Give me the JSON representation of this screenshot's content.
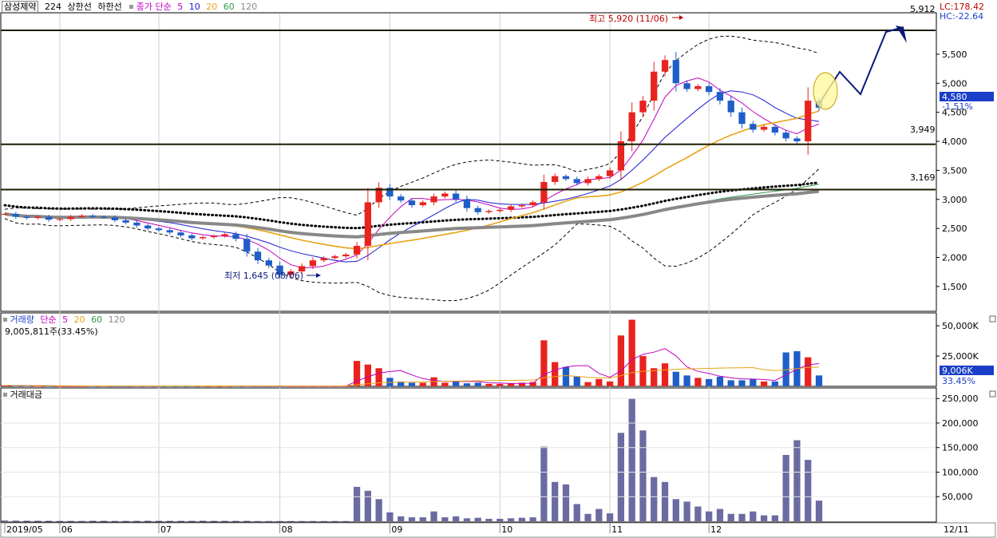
{
  "header": {
    "stock_name": "삼성제약",
    "code": "224",
    "upper_limit": "상한선",
    "lower_limit": "하한선",
    "price_ma_title": "종가 단순",
    "ma_periods": [
      "5",
      "10",
      "20",
      "60",
      "120"
    ],
    "lc_label": "LC:178.42",
    "hc_label": "HC:-22.64"
  },
  "volume_header": {
    "title": "거래량",
    "ma_title": "단순",
    "ma_periods": [
      "5",
      "20",
      "60",
      "120"
    ],
    "value_text": "9,005,811주(33.45%)"
  },
  "amount_header": {
    "title": "거래대금"
  },
  "annotations": {
    "high_label": "최고 5,920 (11/06)",
    "low_label": "최저 1,645 (08/06)",
    "level_top": "5,912",
    "level_mid": "3,949",
    "level_low": "3,169"
  },
  "current": {
    "price": "4,580",
    "change": "-1.51%",
    "volume": "9,006K",
    "volume_pct": "33.45%"
  },
  "x_axis": {
    "labels": [
      "2019/05",
      "06",
      "07",
      "08",
      "09",
      "10",
      "11",
      "12"
    ],
    "right_label": "12/11"
  },
  "colors": {
    "up": "#e8231f",
    "down": "#1f5ec8",
    "ma5": "#c000c0",
    "ma10": "#1b1bd0",
    "ma20": "#e8a317",
    "ma60": "#2e9a4a",
    "ma120": "#888888",
    "level_line": "#1c1c00"
  },
  "chart_data": [
    {
      "type": "candlestick",
      "title": "삼성제약",
      "price_axis_ticks": [
        1500,
        2000,
        2500,
        3000,
        3500,
        4000,
        4500,
        5000,
        5500
      ],
      "ylim": [
        1100,
        6200
      ],
      "horizontal_levels": [
        5912,
        3949,
        3169
      ],
      "series": [
        {
          "name": "종가",
          "values": [
            2750,
            2700,
            2680,
            2700,
            2650,
            2660,
            2700,
            2720,
            2700,
            2690,
            2640,
            2600,
            2550,
            2500,
            2470,
            2430,
            2380,
            2330,
            2350,
            2370,
            2400,
            2320,
            2100,
            1950,
            1860,
            1700,
            1760,
            1850,
            1950,
            1990,
            2020,
            2050,
            2200,
            2950,
            3200,
            3050,
            2980,
            2900,
            2950,
            3050,
            3100,
            3000,
            2850,
            2780,
            2800,
            2820,
            2880,
            2900,
            2950,
            3300,
            3400,
            3350,
            3280,
            3350,
            3400,
            3500,
            4000,
            4500,
            4700,
            5200,
            5400,
            5000,
            4900,
            4950,
            4850,
            4700,
            4500,
            4300,
            4200,
            4250,
            4150,
            4050,
            4000,
            4700,
            4580
          ]
        }
      ]
    },
    {
      "type": "bar",
      "title": "거래량",
      "yticks": [
        25000,
        50000
      ],
      "unit": "K",
      "values": [
        700,
        500,
        400,
        300,
        300,
        200,
        200,
        200,
        300,
        300,
        200,
        200,
        300,
        400,
        300,
        300,
        300,
        300,
        400,
        300,
        300,
        300,
        300,
        200,
        200,
        200,
        200,
        200,
        200,
        200,
        200,
        200,
        21000,
        18000,
        15000,
        7000,
        4000,
        3000,
        3000,
        7500,
        3000,
        4000,
        2500,
        3000,
        2000,
        2000,
        2500,
        3000,
        3500,
        38000,
        20000,
        16000,
        8000,
        3500,
        6000,
        4000,
        42000,
        55000,
        25000,
        15000,
        19000,
        12000,
        9000,
        7000,
        6000,
        8000,
        5000,
        5000,
        6000,
        4000,
        4000,
        28000,
        29000,
        24000,
        9006
      ]
    },
    {
      "type": "bar",
      "title": "거래대금",
      "yticks": [
        50000,
        100000,
        150000,
        200000,
        250000
      ],
      "values": [
        1500,
        1200,
        1000,
        900,
        800,
        600,
        600,
        600,
        800,
        800,
        600,
        600,
        700,
        900,
        700,
        700,
        700,
        700,
        900,
        700,
        700,
        700,
        700,
        400,
        400,
        400,
        400,
        400,
        400,
        400,
        400,
        400,
        70000,
        62000,
        45000,
        18000,
        10000,
        8000,
        8000,
        20000,
        8000,
        10000,
        6000,
        7000,
        5000,
        5000,
        6000,
        7000,
        8000,
        152000,
        80000,
        75000,
        35000,
        15000,
        25000,
        16000,
        180000,
        250000,
        185000,
        90000,
        80000,
        45000,
        40000,
        30000,
        20000,
        25000,
        15000,
        15000,
        20000,
        12000,
        12000,
        135000,
        165000,
        125000,
        42000
      ]
    }
  ]
}
